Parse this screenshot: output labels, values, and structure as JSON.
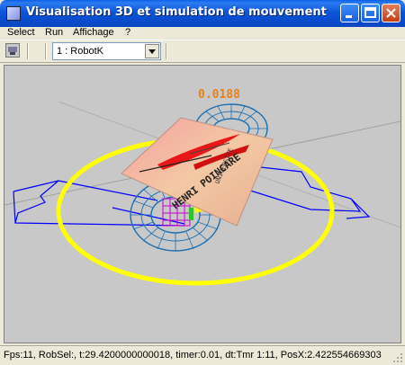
{
  "window": {
    "title": "Visualisation 3D et simulation de mouvement"
  },
  "menu": {
    "items": [
      "Select",
      "Run",
      "Affichage",
      "?"
    ]
  },
  "toolbar": {
    "robot_select": {
      "value": "1 : RobotK"
    }
  },
  "viewport": {
    "value_readout": "0.0188",
    "logo_text": "HENRI POINCARE",
    "logo_text_2": "UNIVERSITE"
  },
  "statusbar": {
    "text": "Fps:11, RobSel:, t:29.4200000000018, timer:0.01, dt:Tmr 1:11, PosX:2.422554669303"
  },
  "colors": {
    "titlebar": "#0A4ACB",
    "viewport_bg": "#c8c8c8",
    "ring": "#ffff00",
    "wireframe_lines": "#0000ff",
    "torus_mesh": "#1e6fb0",
    "readout": "#e8801a"
  }
}
